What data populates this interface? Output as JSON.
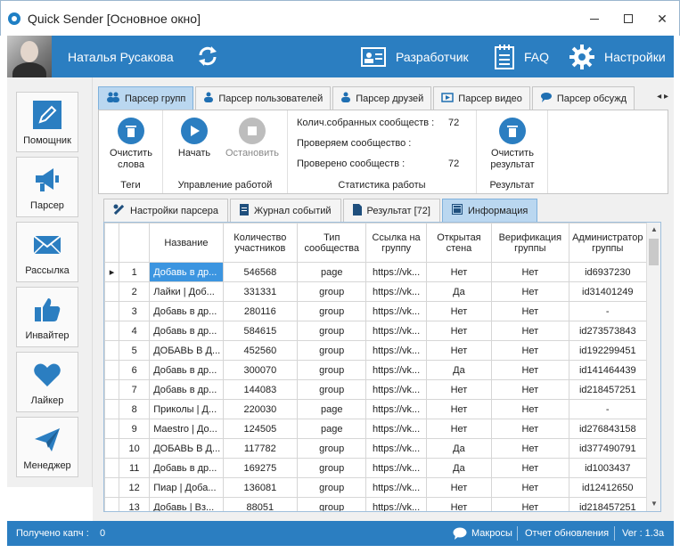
{
  "window": {
    "title": "Quick Sender [Основное окно]"
  },
  "header": {
    "user_name": "Наталья Русакова",
    "developer_label": "Разработчик",
    "faq_label": "FAQ",
    "settings_label": "Настройки"
  },
  "sidebar": {
    "items": [
      {
        "label": "Помощник",
        "icon": "pencil-icon"
      },
      {
        "label": "Парсер",
        "icon": "megaphone-icon"
      },
      {
        "label": "Рассылка",
        "icon": "envelope-icon"
      },
      {
        "label": "Инвайтер",
        "icon": "thumbs-up-icon"
      },
      {
        "label": "Лайкер",
        "icon": "heart-icon"
      },
      {
        "label": "Менеджер",
        "icon": "paper-plane-icon"
      }
    ]
  },
  "top_tabs": [
    {
      "label": "Парсер групп",
      "active": true
    },
    {
      "label": "Парсер пользователей"
    },
    {
      "label": "Парсер друзей"
    },
    {
      "label": "Парсер видео"
    },
    {
      "label": "Парсер обсужд"
    }
  ],
  "ribbon": {
    "tags_group": {
      "name": "Теги",
      "clear_words": "Очистить слова"
    },
    "work_group": {
      "name": "Управление работой",
      "start": "Начать",
      "stop": "Остановить"
    },
    "stats_group": {
      "name": "Статистика работы",
      "collected_label": "Колич.собранных сообществ :",
      "collected_value": "72",
      "checking_label": "Проверяем сообщество :",
      "checking_value": "",
      "checked_label": "Проверено сообществ :",
      "checked_value": "72"
    },
    "result_group": {
      "name": "Результат",
      "clear_result": "Очистить результат"
    }
  },
  "sub_tabs": [
    {
      "label": "Настройки парсера"
    },
    {
      "label": "Журнал событий"
    },
    {
      "label": "Результат [72]"
    },
    {
      "label": "Информация",
      "active": true
    }
  ],
  "grid": {
    "columns": [
      "",
      "Название",
      "Количество участников",
      "Тип сообщества",
      "Ссылка на группу",
      "Открытая стена",
      "Верификация группы",
      "Администратор группы"
    ],
    "rows": [
      [
        "1",
        "Добавь в др...",
        "546568",
        "page",
        "https://vk...",
        "Нет",
        "Нет",
        "id6937230"
      ],
      [
        "2",
        "Лайки | Доб...",
        "331331",
        "group",
        "https://vk...",
        "Да",
        "Нет",
        "id31401249"
      ],
      [
        "3",
        "Добавь в др...",
        "280116",
        "group",
        "https://vk...",
        "Нет",
        "Нет",
        "-"
      ],
      [
        "4",
        "Добавь в др...",
        "584615",
        "group",
        "https://vk...",
        "Нет",
        "Нет",
        "id273573843"
      ],
      [
        "5",
        "ДОБАВЬ В Д...",
        "452560",
        "group",
        "https://vk...",
        "Нет",
        "Нет",
        "id192299451"
      ],
      [
        "6",
        "Добавь в др...",
        "300070",
        "group",
        "https://vk...",
        "Да",
        "Нет",
        "id141464439"
      ],
      [
        "7",
        "Добавь в др...",
        "144083",
        "group",
        "https://vk...",
        "Нет",
        "Нет",
        "id218457251"
      ],
      [
        "8",
        "Приколы | Д...",
        "220030",
        "page",
        "https://vk...",
        "Нет",
        "Нет",
        "-"
      ],
      [
        "9",
        "Maestro | До...",
        "124505",
        "page",
        "https://vk...",
        "Нет",
        "Нет",
        "id276843158"
      ],
      [
        "10",
        "ДОБАВЬ В Д...",
        "117782",
        "group",
        "https://vk...",
        "Да",
        "Нет",
        "id377490791"
      ],
      [
        "11",
        "Добавь в др...",
        "169275",
        "group",
        "https://vk...",
        "Да",
        "Нет",
        "id1003437"
      ],
      [
        "12",
        "Пиар | Доба...",
        "136081",
        "group",
        "https://vk...",
        "Нет",
        "Нет",
        "id12412650"
      ],
      [
        "13",
        "Добавь | Вз...",
        "88051",
        "group",
        "https://vk...",
        "Нет",
        "Нет",
        "id218457251"
      ]
    ]
  },
  "status": {
    "captcha_label": "Получено капч :",
    "captcha_value": "0",
    "macros": "Макросы",
    "update_report": "Отчет обновления",
    "version": "Ver : 1.3a"
  },
  "colors": {
    "accent": "#2b7ec1",
    "selection": "#3c95e0",
    "tab_active": "#bad7f0"
  }
}
